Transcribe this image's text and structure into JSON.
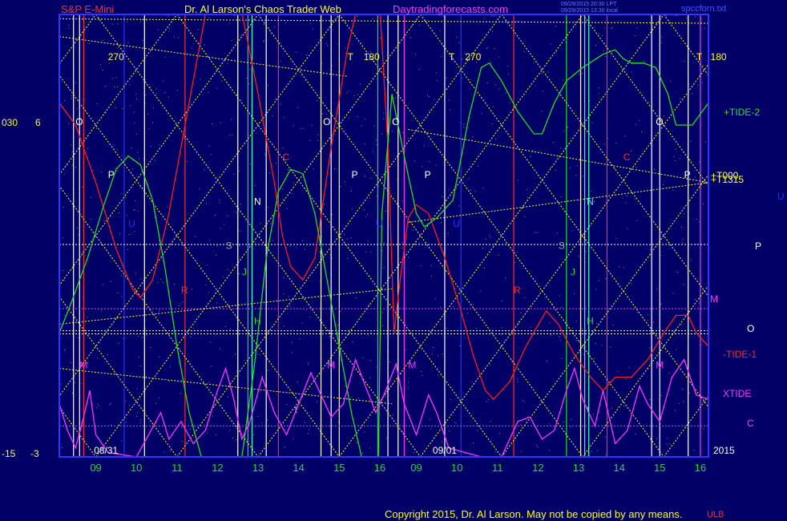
{
  "header": {
    "symbol": "S&P E-Mini",
    "site_title": "Dr. Al Larson's Chaos Trader Web",
    "url": "Daytradingforecasts.com",
    "stamp1": "09/29/2015 20:30 LPT",
    "stamp2": "09/29/2015 13:30 local",
    "filename": "spccforn.txt",
    "copyright": "Copyright 2015, Dr. Al Larson. May not be copied by any means.",
    "corner_mark": "ULB"
  },
  "left_axis": {
    "top_label_a": "030",
    "top_label_b": "6",
    "bottom_label_a": "-15",
    "bottom_label_b": "-3"
  },
  "colors": {
    "background": "#000066",
    "frame": "#3333ff",
    "grid_dots": "#c8c8c8",
    "gann_lines": "#ffff33",
    "red_series": "#ff1a1a",
    "green_series": "#22dd22",
    "magenta_series": "#ff33ff",
    "white_lines": "#ffffff",
    "cyan": "#33ffcc"
  },
  "chart_data": {
    "type": "line",
    "x_ticks": [
      "09",
      "10",
      "11",
      "12",
      "13",
      "14",
      "15",
      "16",
      "09",
      "10",
      "11",
      "12",
      "13",
      "14",
      "15",
      "16"
    ],
    "date_marks": [
      {
        "label": "08/31",
        "x": 0.25
      },
      {
        "label": "09/01",
        "x": 8.6
      }
    ],
    "year_label": "2015",
    "x_range": [
      -0.9,
      15.1
    ],
    "y_range": [
      0,
      100
    ],
    "series": [
      {
        "color": "red",
        "points": [
          [
            -0.9,
            80
          ],
          [
            -0.5,
            75
          ],
          [
            0,
            62
          ],
          [
            0.5,
            47
          ],
          [
            0.9,
            38
          ],
          [
            1.1,
            36
          ],
          [
            1.4,
            40
          ],
          [
            1.8,
            55
          ],
          [
            2.2,
            75
          ],
          [
            2.6,
            95
          ],
          [
            3,
            115
          ],
          [
            3.5,
            105
          ],
          [
            4,
            82
          ],
          [
            4.4,
            62
          ],
          [
            4.6,
            50
          ],
          [
            4.8,
            43
          ],
          [
            5.1,
            40
          ],
          [
            5.4,
            45
          ],
          [
            5.8,
            70
          ],
          [
            6.2,
            92
          ],
          [
            6.6,
            108
          ],
          [
            7.0,
            102
          ],
          [
            7.2,
            70
          ],
          [
            7.35,
            28
          ],
          [
            7.5,
            40
          ],
          [
            7.7,
            54
          ],
          [
            7.9,
            57
          ],
          [
            8.2,
            55
          ],
          [
            8.6,
            45
          ],
          [
            9.0,
            33
          ],
          [
            9.3,
            23
          ],
          [
            9.6,
            15
          ],
          [
            9.8,
            13
          ],
          [
            10.2,
            17
          ],
          [
            10.6,
            25
          ],
          [
            11.1,
            33
          ],
          [
            11.4,
            30
          ],
          [
            11.8,
            23
          ],
          [
            12.2,
            18
          ],
          [
            12.5,
            15
          ],
          [
            12.8,
            18
          ],
          [
            13.2,
            18
          ],
          [
            13.6,
            22
          ],
          [
            14,
            28
          ],
          [
            14.3,
            32
          ],
          [
            14.6,
            32
          ],
          [
            14.8,
            28
          ],
          [
            15.1,
            25
          ]
        ]
      },
      {
        "color": "green",
        "points": [
          [
            -0.9,
            28
          ],
          [
            -0.6,
            35
          ],
          [
            -0.2,
            45
          ],
          [
            0.2,
            57
          ],
          [
            0.5,
            65
          ],
          [
            0.8,
            68
          ],
          [
            1.1,
            66
          ],
          [
            1.4,
            58
          ],
          [
            1.7,
            43
          ],
          [
            2,
            25
          ],
          [
            2.3,
            10
          ],
          [
            2.6,
            0
          ],
          [
            3.2,
            -5
          ],
          [
            3.6,
            0
          ],
          [
            3.9,
            20
          ],
          [
            4.2,
            45
          ],
          [
            4.5,
            60
          ],
          [
            4.8,
            65
          ],
          [
            5.1,
            64
          ],
          [
            5.4,
            55
          ],
          [
            5.7,
            40
          ],
          [
            6.0,
            25
          ],
          [
            6.3,
            10
          ],
          [
            6.6,
            -2
          ],
          [
            6.95,
            -10
          ],
          [
            7.05,
            55
          ],
          [
            7.3,
            82
          ],
          [
            7.6,
            68
          ],
          [
            7.9,
            55
          ],
          [
            8.1,
            52
          ],
          [
            8.4,
            54
          ],
          [
            8.8,
            58
          ],
          [
            9.2,
            77
          ],
          [
            9.5,
            88
          ],
          [
            9.7,
            89
          ],
          [
            10.0,
            85
          ],
          [
            10.4,
            78
          ],
          [
            10.8,
            73
          ],
          [
            11.0,
            73
          ],
          [
            11.3,
            80
          ],
          [
            11.6,
            85
          ],
          [
            12,
            88
          ],
          [
            12.5,
            91
          ],
          [
            12.8,
            92
          ],
          [
            13.0,
            90
          ],
          [
            13.2,
            89
          ],
          [
            13.5,
            89
          ],
          [
            13.8,
            88
          ],
          [
            14.1,
            82
          ],
          [
            14.3,
            75
          ],
          [
            14.7,
            75
          ],
          [
            15.1,
            80
          ]
        ]
      },
      {
        "color": "magenta",
        "points": [
          [
            -0.9,
            12
          ],
          [
            -0.7,
            6
          ],
          [
            -0.5,
            2
          ],
          [
            -0.3,
            9
          ],
          [
            -0.15,
            15
          ],
          [
            0,
            5
          ],
          [
            0.3,
            1
          ],
          [
            1,
            0
          ],
          [
            1.3,
            5
          ],
          [
            1.6,
            10
          ],
          [
            1.8,
            4
          ],
          [
            2.1,
            8
          ],
          [
            2.4,
            3
          ],
          [
            2.7,
            6
          ],
          [
            3.0,
            15
          ],
          [
            3.2,
            20
          ],
          [
            3.4,
            13
          ],
          [
            3.6,
            4
          ],
          [
            3.8,
            8
          ],
          [
            4.1,
            18
          ],
          [
            4.4,
            10
          ],
          [
            4.7,
            5
          ],
          [
            5,
            12
          ],
          [
            5.3,
            19
          ],
          [
            5.5,
            15
          ],
          [
            5.8,
            9
          ],
          [
            6.1,
            12
          ],
          [
            6.4,
            22
          ],
          [
            6.6,
            17
          ],
          [
            6.9,
            10
          ],
          [
            7.1,
            14
          ],
          [
            7.4,
            21
          ],
          [
            7.6,
            12
          ],
          [
            7.9,
            5
          ],
          [
            8.2,
            14
          ],
          [
            8.4,
            10
          ],
          [
            8.7,
            2
          ],
          [
            9.5,
            0
          ],
          [
            10,
            0
          ],
          [
            10.4,
            8
          ],
          [
            10.7,
            9
          ],
          [
            11.0,
            4
          ],
          [
            11.3,
            6
          ],
          [
            11.6,
            15
          ],
          [
            11.8,
            20
          ],
          [
            12.0,
            13
          ],
          [
            12.3,
            7
          ],
          [
            12.5,
            15
          ],
          [
            12.8,
            3
          ],
          [
            13.1,
            6
          ],
          [
            13.4,
            16
          ],
          [
            13.6,
            12
          ],
          [
            13.9,
            8
          ],
          [
            14.2,
            18
          ],
          [
            14.5,
            22
          ],
          [
            14.8,
            14
          ],
          [
            15.1,
            13
          ]
        ]
      }
    ]
  },
  "right_labels": {
    "tide2": "+TIDE-2",
    "t1315": "+T1315",
    "t000": "+T000",
    "u": "U",
    "p": "P",
    "m": "M",
    "o": "O",
    "tide1": "-TIDE-1",
    "xtide": "XTIDE",
    "c": "C"
  },
  "top_marks": [
    {
      "text": "270",
      "x": 0.3
    },
    {
      "text": "T",
      "x": 6.2
    },
    {
      "text": "180",
      "x": 6.6
    },
    {
      "text": "T",
      "x": 8.7
    },
    {
      "text": "270",
      "x": 9.1
    },
    {
      "text": "T",
      "x": 14.8
    },
    {
      "text": "180",
      "x": 15.15
    }
  ],
  "chart_letters": [
    {
      "text": "O",
      "x": -0.5,
      "y": 75,
      "color": "white"
    },
    {
      "text": "P",
      "x": 0.3,
      "y": 63,
      "color": "white"
    },
    {
      "text": "U",
      "x": 0.8,
      "y": 52,
      "color": "blue"
    },
    {
      "text": "R",
      "x": 2.1,
      "y": 37,
      "color": "red"
    },
    {
      "text": "S",
      "x": 3.2,
      "y": 47,
      "color": "gray"
    },
    {
      "text": "N",
      "x": 3.9,
      "y": 57,
      "color": "white"
    },
    {
      "text": "J",
      "x": 3.6,
      "y": 41,
      "color": "green"
    },
    {
      "text": "H",
      "x": 3.9,
      "y": 30,
      "color": "green"
    },
    {
      "text": "C",
      "x": 4.6,
      "y": 67,
      "color": "red"
    },
    {
      "text": "O",
      "x": 5.6,
      "y": 75,
      "color": "white"
    },
    {
      "text": "P",
      "x": 6.3,
      "y": 63,
      "color": "white"
    },
    {
      "text": "O",
      "x": 7.3,
      "y": 75,
      "color": "white"
    },
    {
      "text": "U",
      "x": 6.9,
      "y": 52,
      "color": "blue"
    },
    {
      "text": "P",
      "x": 8.1,
      "y": 63,
      "color": "white"
    },
    {
      "text": "U",
      "x": 8.8,
      "y": 52,
      "color": "blue"
    },
    {
      "text": "R",
      "x": 10.3,
      "y": 37,
      "color": "red"
    },
    {
      "text": "S",
      "x": 11.4,
      "y": 47,
      "color": "gray"
    },
    {
      "text": "J",
      "x": 11.7,
      "y": 41,
      "color": "green"
    },
    {
      "text": "N",
      "x": 12.1,
      "y": 57,
      "color": "cyan"
    },
    {
      "text": "H",
      "x": 12.1,
      "y": 30,
      "color": "green"
    },
    {
      "text": "C",
      "x": 13.0,
      "y": 67,
      "color": "red"
    },
    {
      "text": "O",
      "x": 13.8,
      "y": 75,
      "color": "white"
    },
    {
      "text": "P",
      "x": 14.5,
      "y": 63,
      "color": "white"
    },
    {
      "text": "M",
      "x": -0.4,
      "y": 20,
      "color": "magenta"
    },
    {
      "text": "M",
      "x": 5.7,
      "y": 20,
      "color": "magenta"
    },
    {
      "text": "M",
      "x": 7.7,
      "y": 20,
      "color": "magenta"
    },
    {
      "text": "M",
      "x": 13.8,
      "y": 20,
      "color": "magenta"
    },
    {
      "text": "t",
      "x": 4.9,
      "y": 10,
      "color": "gray"
    },
    {
      "text": "t",
      "x": 12.1,
      "y": 10,
      "color": "gray"
    }
  ]
}
